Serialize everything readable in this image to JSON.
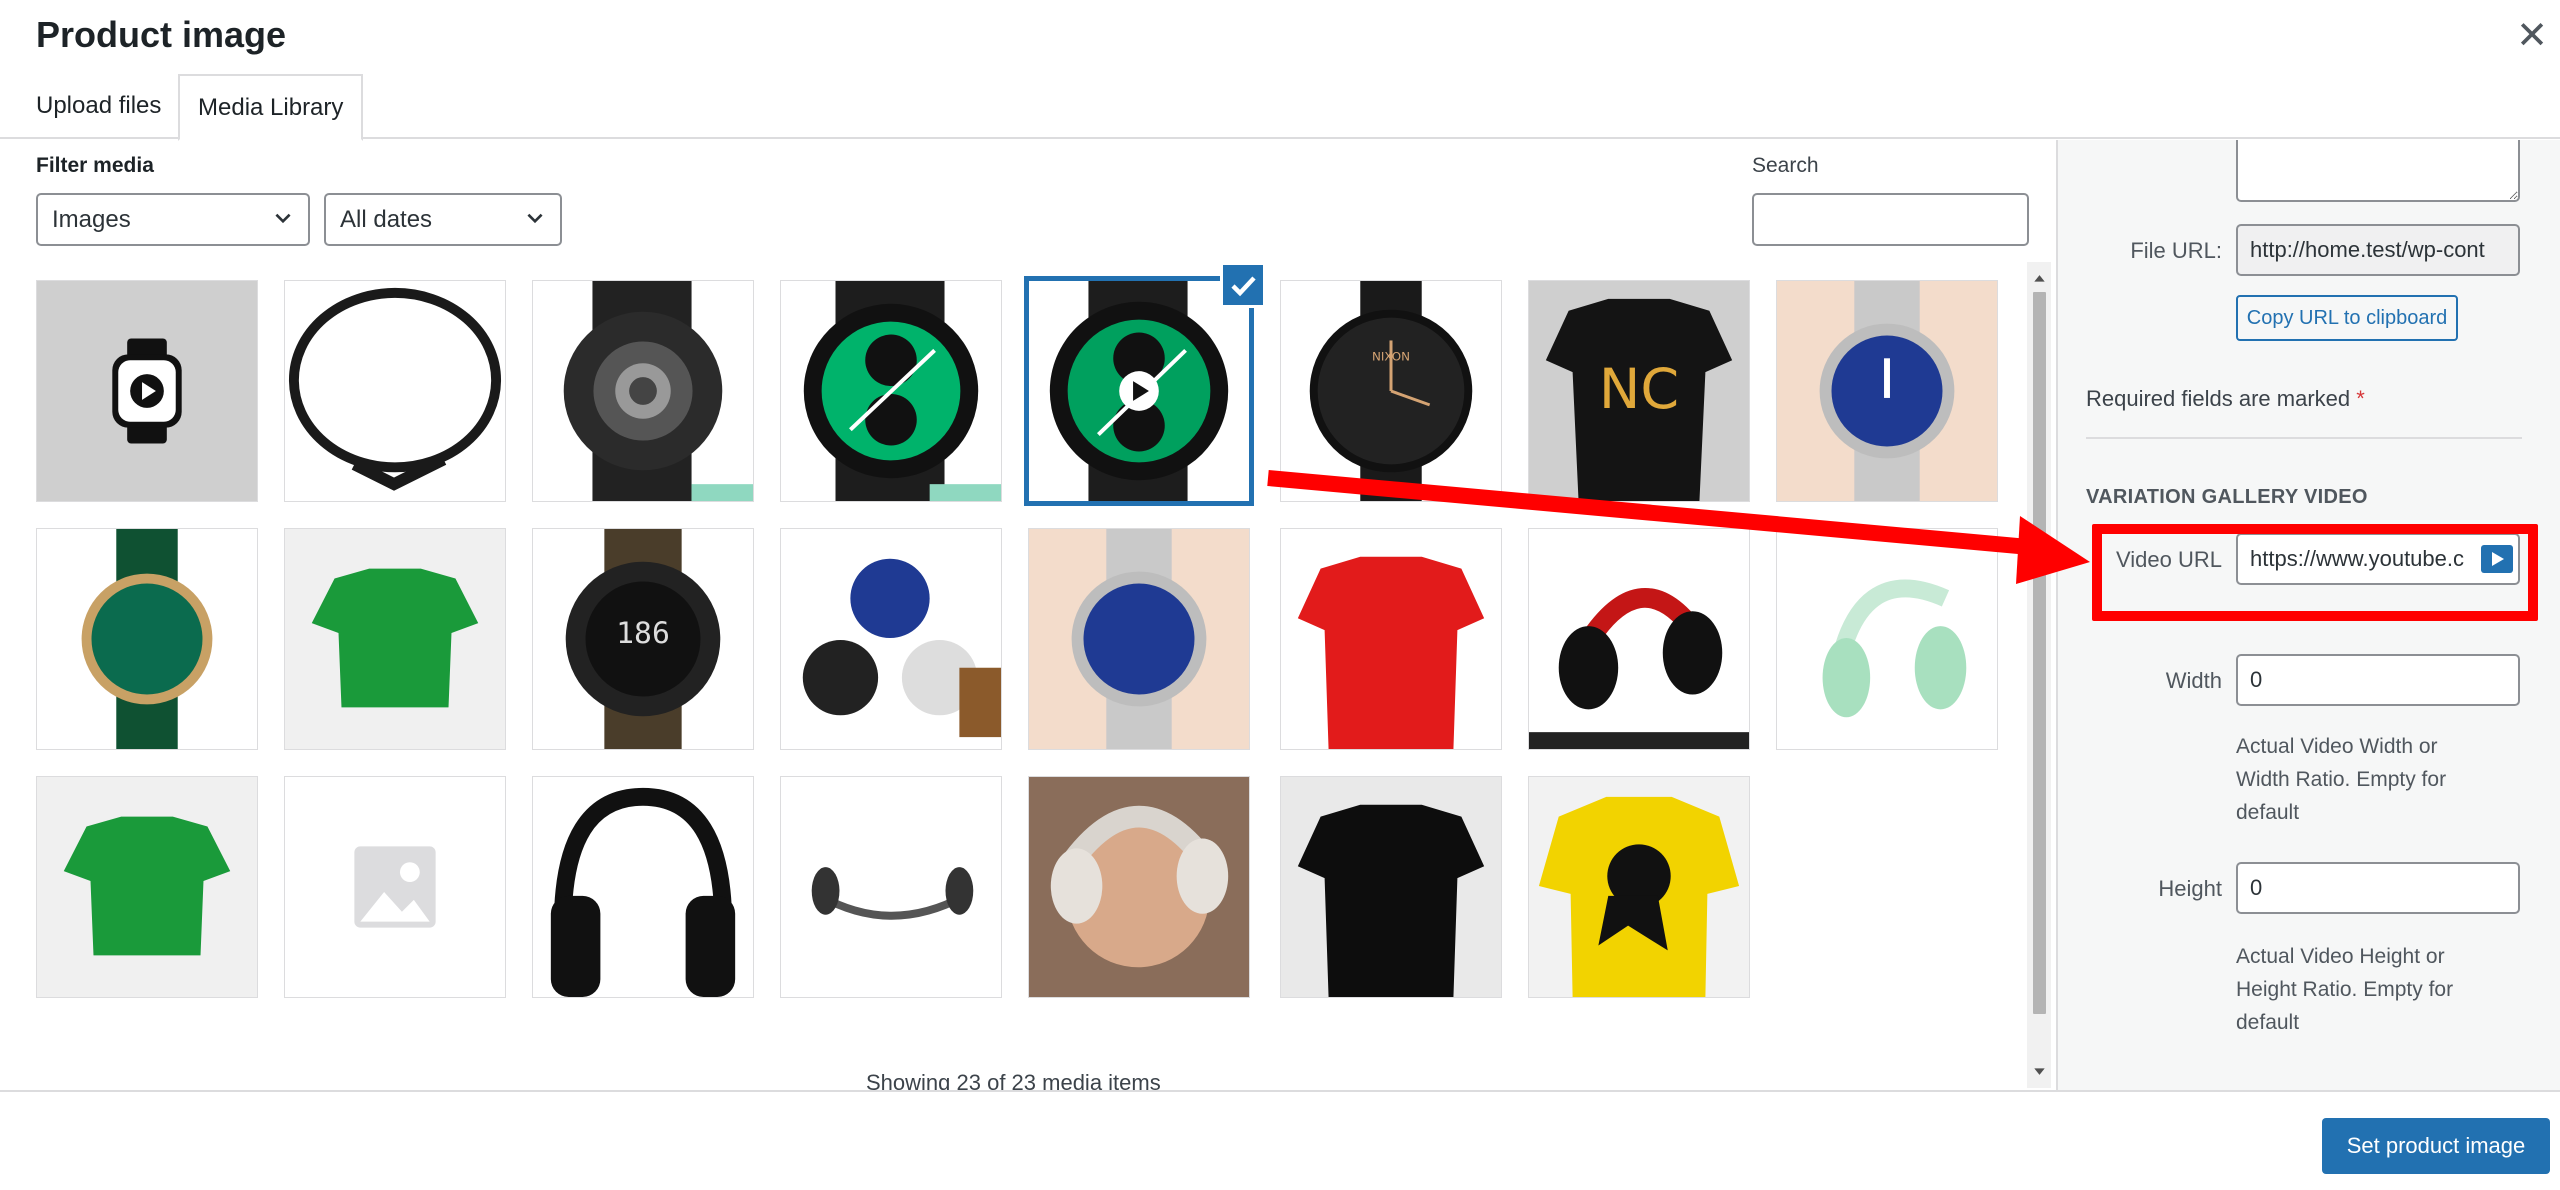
{
  "modal": {
    "title": "Product image",
    "close_icon": "close-icon",
    "tabs": [
      {
        "label": "Upload files",
        "active": false
      },
      {
        "label": "Media Library",
        "active": true
      }
    ]
  },
  "filters": {
    "label": "Filter media",
    "type_select": "Images",
    "date_select": "All dates",
    "search_label": "Search",
    "search_value": ""
  },
  "media": {
    "items": [
      {
        "name": "watch-video-placeholder",
        "selected": false
      },
      {
        "name": "watch-band-round",
        "selected": false
      },
      {
        "name": "black-smartwatch-back",
        "selected": false
      },
      {
        "name": "green-smartwatch-8",
        "selected": false
      },
      {
        "name": "green-smartwatch-video",
        "selected": true
      },
      {
        "name": "nixon-black-watch",
        "selected": false
      },
      {
        "name": "black-tshirt-nc",
        "selected": false
      },
      {
        "name": "blue-dial-steel-watch",
        "selected": false
      },
      {
        "name": "green-leather-watch",
        "selected": false
      },
      {
        "name": "green-tshirt",
        "selected": false
      },
      {
        "name": "digital-sport-watch",
        "selected": false
      },
      {
        "name": "watch-collection",
        "selected": false
      },
      {
        "name": "blue-dial-steel-watch-2",
        "selected": false
      },
      {
        "name": "red-tshirt",
        "selected": false
      },
      {
        "name": "red-black-headphones",
        "selected": false
      },
      {
        "name": "mint-headphones",
        "selected": false
      },
      {
        "name": "green-tshirt-2",
        "selected": false
      },
      {
        "name": "image-placeholder",
        "selected": false
      },
      {
        "name": "black-headphones",
        "selected": false
      },
      {
        "name": "bone-conduction-headset",
        "selected": false
      },
      {
        "name": "woman-headphones",
        "selected": false
      },
      {
        "name": "black-tshirt",
        "selected": false
      },
      {
        "name": "yellow-tshirt",
        "selected": false
      }
    ],
    "showing_text": "Showing 23 of 23 media items"
  },
  "details": {
    "file_url_label": "File URL:",
    "file_url_value": "http://home.test/wp-cont",
    "copy_button": "Copy URL to clipboard",
    "required_text": "Required fields are marked",
    "required_star": "*",
    "section_heading": "VARIATION GALLERY VIDEO",
    "video_url_label": "Video URL",
    "video_url_value": "https://www.youtube.c",
    "width_label": "Width",
    "width_value": "0",
    "width_help": "Actual Video Width or Width Ratio. Empty for default",
    "height_label": "Height",
    "height_value": "0",
    "height_help": "Actual Video Height or Height Ratio. Empty for default"
  },
  "footer": {
    "primary_button": "Set product image"
  },
  "colors": {
    "accent": "#2271b1",
    "annotation": "#ff0000"
  }
}
